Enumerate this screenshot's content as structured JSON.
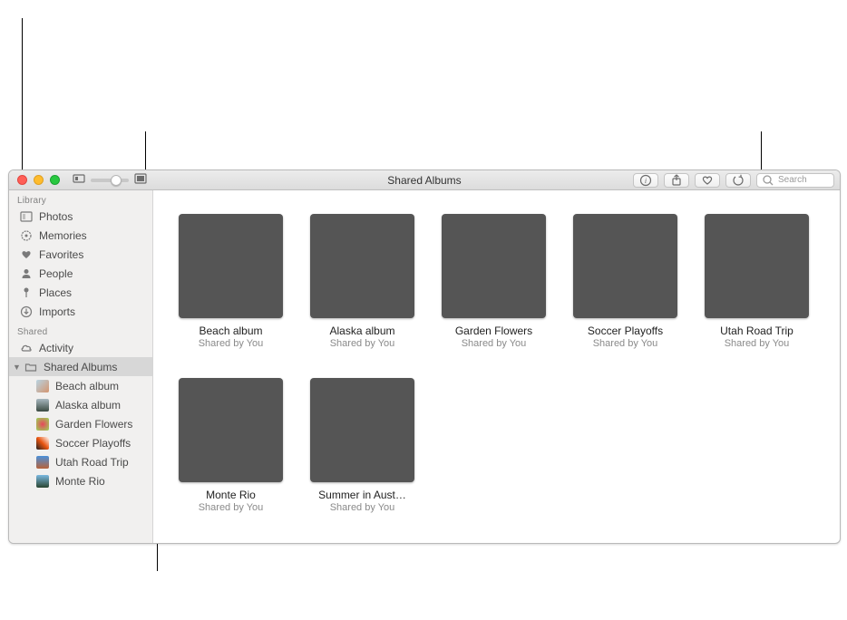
{
  "window_title": "Shared Albums",
  "toolbar": {
    "search_placeholder": "Search"
  },
  "sidebar": {
    "sections": {
      "library_header": "Library",
      "shared_header": "Shared"
    },
    "library": [
      {
        "label": "Photos"
      },
      {
        "label": "Memories"
      },
      {
        "label": "Favorites"
      },
      {
        "label": "People"
      },
      {
        "label": "Places"
      },
      {
        "label": "Imports"
      }
    ],
    "shared": {
      "activity_label": "Activity",
      "shared_albums_label": "Shared Albums",
      "children": [
        {
          "label": "Beach album"
        },
        {
          "label": "Alaska album"
        },
        {
          "label": "Garden Flowers"
        },
        {
          "label": "Soccer Playoffs"
        },
        {
          "label": "Utah Road Trip"
        },
        {
          "label": "Monte Rio"
        }
      ]
    }
  },
  "albums": [
    {
      "title": "Beach album",
      "subtitle": "Shared by You"
    },
    {
      "title": "Alaska album",
      "subtitle": "Shared by You"
    },
    {
      "title": "Garden Flowers",
      "subtitle": "Shared by You"
    },
    {
      "title": "Soccer Playoffs",
      "subtitle": "Shared by You"
    },
    {
      "title": "Utah Road Trip",
      "subtitle": "Shared by You"
    },
    {
      "title": "Monte Rio",
      "subtitle": "Shared by You"
    },
    {
      "title": "Summer in Aust…",
      "subtitle": "Shared by You"
    }
  ]
}
